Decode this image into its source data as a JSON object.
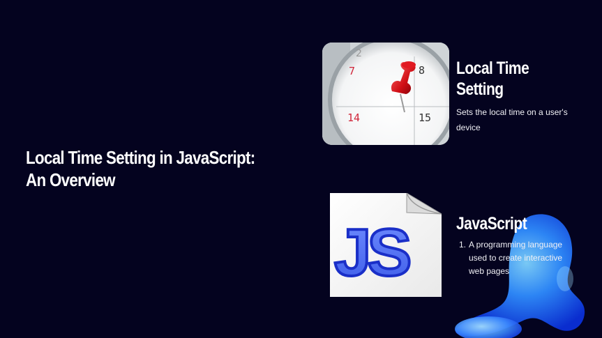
{
  "slide": {
    "title": "Local Time Setting in JavaScript: An Overview",
    "background_color": "#04031f",
    "accent_color": "#2a7bff"
  },
  "cards": [
    {
      "image_icon": "calendar-pushpin-image",
      "title": "Local Time Setting",
      "description": "Sets the local time on a user's device",
      "calendar_numbers": [
        "7",
        "8",
        "14",
        "15",
        "2"
      ]
    },
    {
      "image_icon": "javascript-file-image",
      "image_text": "JS",
      "title": "JavaScript",
      "list": [
        {
          "number": "1.",
          "text": "A programming language used to create interactive web pages"
        }
      ]
    }
  ]
}
